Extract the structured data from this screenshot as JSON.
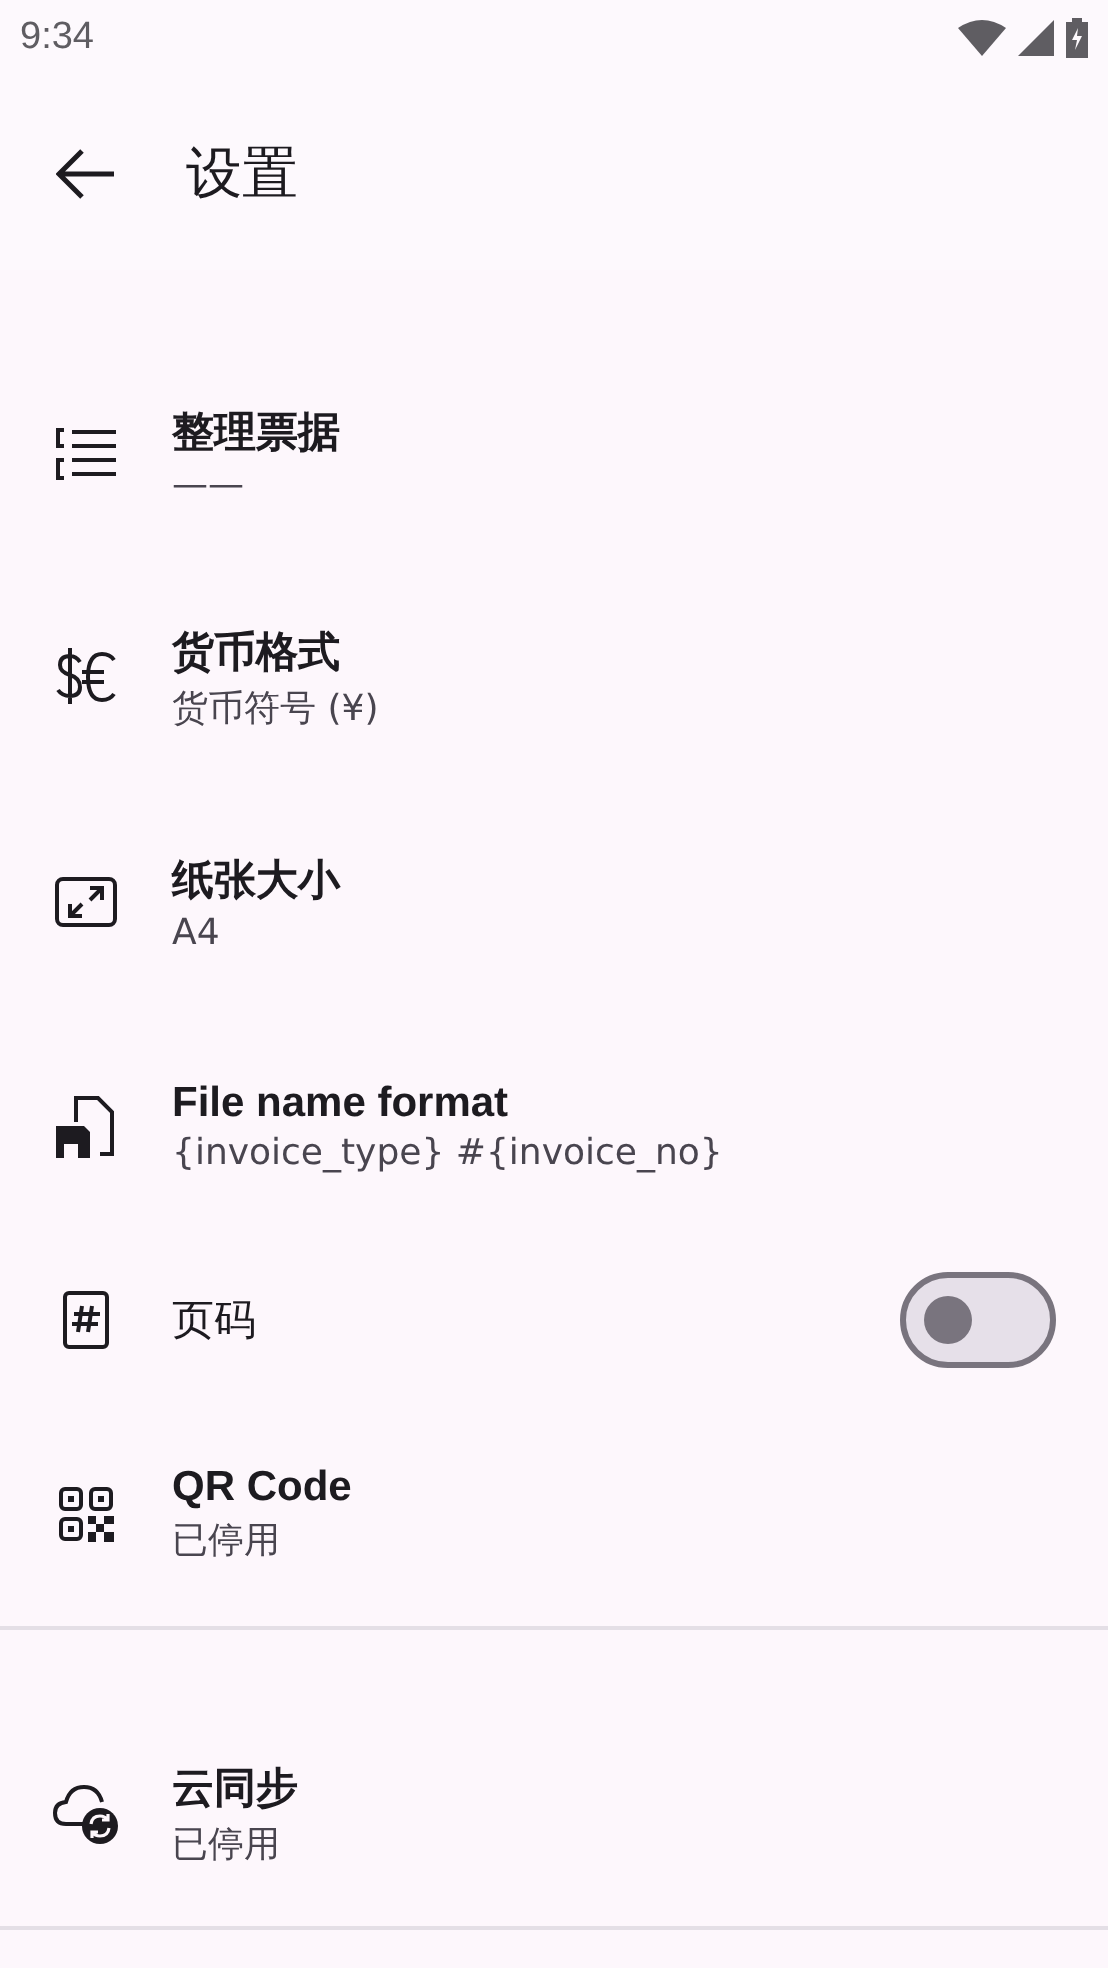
{
  "status_bar": {
    "time": "9:34"
  },
  "app_bar": {
    "title": "设置"
  },
  "sections": [
    {
      "items": [
        {
          "kind": "text",
          "title": "整理票据",
          "subtitle": "——"
        },
        {
          "kind": "text",
          "title": "货币格式",
          "subtitle": "货币符号 (¥)"
        },
        {
          "kind": "text",
          "title": "纸张大小",
          "subtitle": "A4"
        },
        {
          "kind": "text",
          "title": "File name format",
          "subtitle": "{invoice_type} #{invoice_no}"
        },
        {
          "kind": "switch",
          "title": "页码",
          "on": false
        },
        {
          "kind": "text",
          "title": "QR Code",
          "subtitle": "已停用"
        }
      ]
    },
    {
      "items": [
        {
          "kind": "text",
          "title": "云同步",
          "subtitle": "已停用"
        }
      ]
    }
  ]
}
